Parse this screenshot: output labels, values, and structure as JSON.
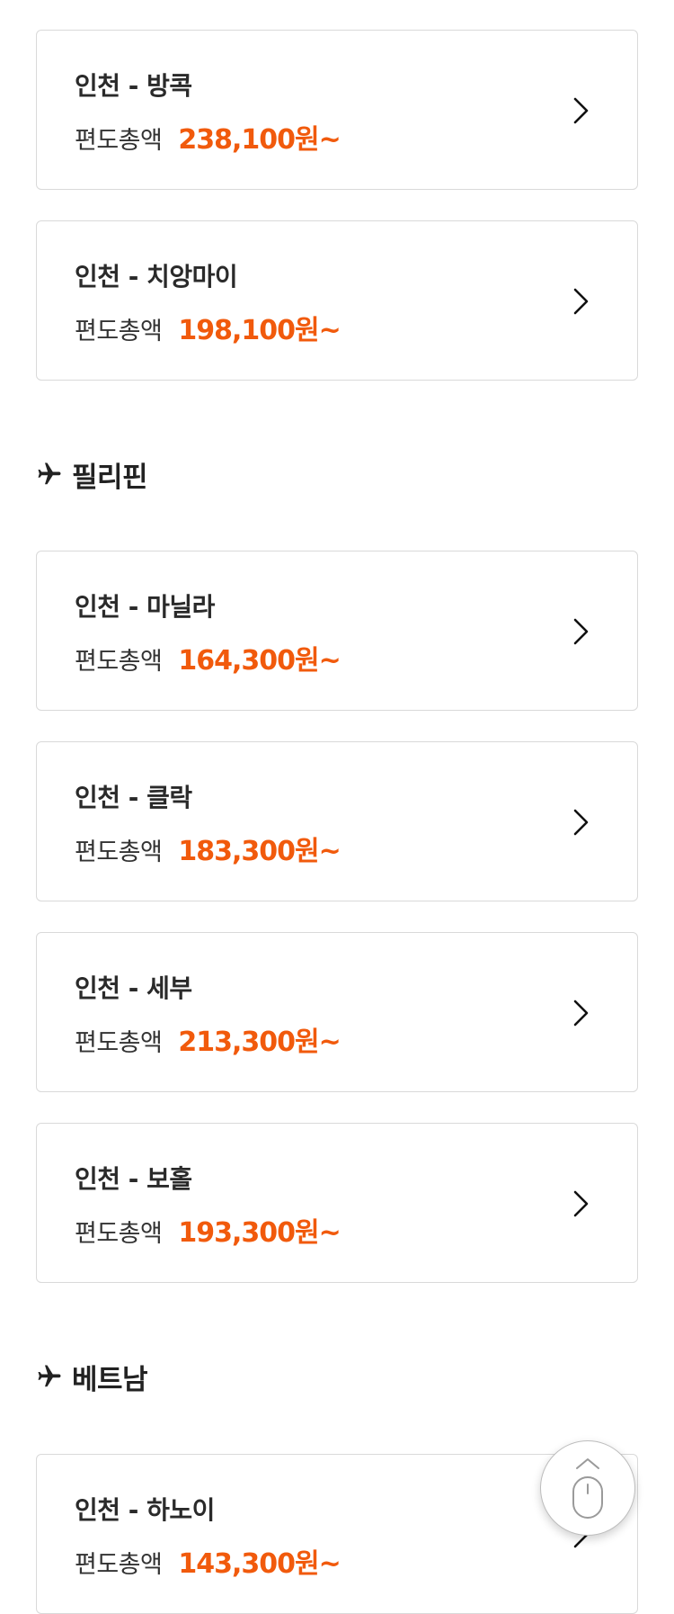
{
  "fare_label": "편도총액",
  "colors": {
    "price": "#f15a0c",
    "text": "#222222",
    "border": "#d9d9d9"
  },
  "sections": [
    {
      "title": "",
      "routes": [
        {
          "route": "인천 - 방콕",
          "price": "238,100원~"
        },
        {
          "route": "인천 - 치앙마이",
          "price": "198,100원~"
        }
      ]
    },
    {
      "title": "필리핀",
      "icon": "airplane-icon",
      "routes": [
        {
          "route": "인천 - 마닐라",
          "price": "164,300원~"
        },
        {
          "route": "인천 - 클락",
          "price": "183,300원~"
        },
        {
          "route": "인천 - 세부",
          "price": "213,300원~"
        },
        {
          "route": "인천 - 보홀",
          "price": "193,300원~"
        }
      ]
    },
    {
      "title": "베트남",
      "icon": "airplane-icon",
      "routes": [
        {
          "route": "인천 - 하노이",
          "price": "143,300원~"
        }
      ]
    }
  ],
  "floating_button": {
    "icon": "mouse-scroll-top-icon"
  }
}
